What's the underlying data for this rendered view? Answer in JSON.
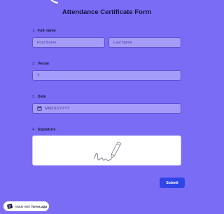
{
  "form": {
    "title": "Attendance Certificate Form"
  },
  "questions": {
    "full_name": {
      "number": "1.",
      "label": "Full name",
      "first_placeholder": "First Name",
      "last_placeholder": "Last Name"
    },
    "venue": {
      "number": "2.",
      "label": "Venue",
      "value": "T"
    },
    "date": {
      "number": "3.",
      "label": "Date",
      "placeholder": "MM/DD/YYYY"
    },
    "signature": {
      "number": "4.",
      "label": "Signature"
    }
  },
  "actions": {
    "submit_label": "Submit"
  },
  "branding": {
    "made_with": "Made with",
    "product": "forms.app"
  },
  "colors": {
    "background": "#7b6cf6",
    "field_bg": "#a49cf8",
    "accent": "#2f45e8"
  },
  "icons": {
    "date": "calendar-icon",
    "signature": "pen-signature-icon",
    "brand": "forms-app-logo-icon"
  }
}
